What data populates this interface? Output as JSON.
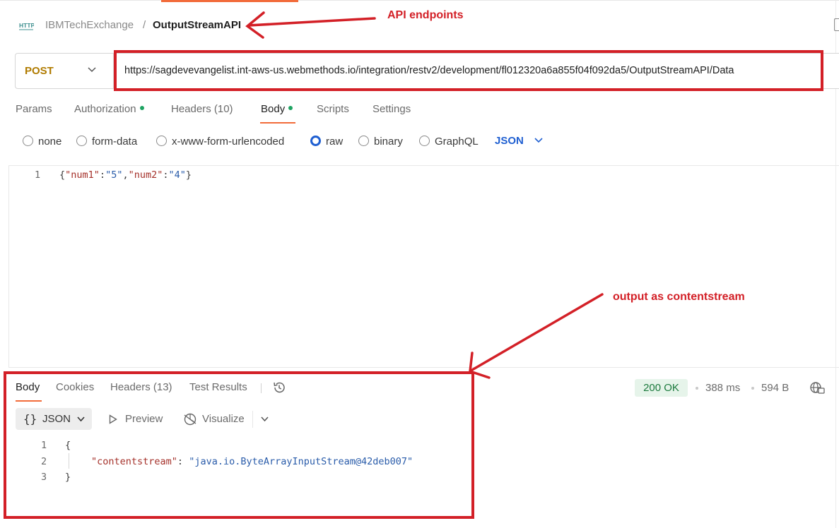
{
  "breadcrumb": {
    "parent": "IBMTechExchange",
    "separator": "/",
    "current": "OutputStreamAPI",
    "protocol_badge": "HTTP"
  },
  "request": {
    "method": "POST",
    "url": "https://sagdevevangelist.int-aws-us.webmethods.io/integration/restv2/development/fl012320a6a855f04f092da5/OutputStreamAPI/Data"
  },
  "request_tabs": [
    {
      "label": "Params"
    },
    {
      "label": "Authorization"
    },
    {
      "label": "Headers (10)"
    },
    {
      "label": "Body"
    },
    {
      "label": "Scripts"
    },
    {
      "label": "Settings"
    }
  ],
  "body_types": {
    "options": [
      "none",
      "form-data",
      "x-www-form-urlencoded",
      "raw",
      "binary",
      "GraphQL"
    ],
    "selected": "raw",
    "format": "JSON"
  },
  "request_body": {
    "line_numbers": [
      "1"
    ],
    "open": "{",
    "k1": "\"num1\"",
    "colon": ":",
    "v1": "\"5\"",
    "comma": ",",
    "k2": "\"num2\"",
    "v2": "\"4\"",
    "close": "}"
  },
  "response_tabs": [
    {
      "label": "Body"
    },
    {
      "label": "Cookies"
    },
    {
      "label": "Headers (13)"
    },
    {
      "label": "Test Results"
    }
  ],
  "response_meta": {
    "status": "200 OK",
    "time": "388 ms",
    "size": "594 B"
  },
  "response_toolbar": {
    "format_braces": "{}",
    "format": "JSON",
    "preview": "Preview",
    "visualize": "Visualize"
  },
  "response_body": {
    "line_numbers": [
      "1",
      "2",
      "3"
    ],
    "open": "{",
    "key": "\"contentstream\"",
    "colon": ": ",
    "value": "\"java.io.ByteArrayInputStream@42deb007\"",
    "close": "}"
  },
  "annotations": {
    "endpoint_note": "API endpoints",
    "output_note": "output as contentstream",
    "color": "#d32027"
  },
  "colors": {
    "accent": "#f26b3a",
    "method": "#b07b00",
    "link": "#1f5fd1",
    "ok_badge_bg": "#e6f4ea",
    "ok_badge_text": "#1b7a3d"
  }
}
